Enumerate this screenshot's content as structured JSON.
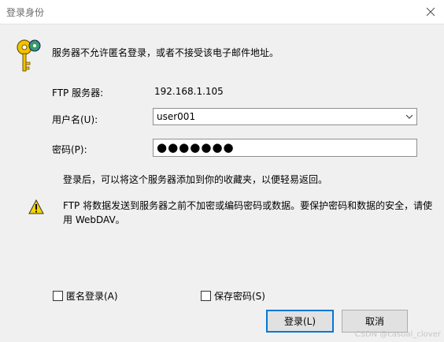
{
  "window": {
    "title": "登录身份"
  },
  "message": "服务器不允许匿名登录，或者不接受该电子邮件地址。",
  "form": {
    "server_label": "FTP 服务器:",
    "server_value": "192.168.1.105",
    "username_label": "用户名(U):",
    "username_value": "user001",
    "password_label": "密码(P):",
    "password_mask": "●●●●●●●"
  },
  "hint": "登录后，可以将这个服务器添加到你的收藏夹，以便轻易返回。",
  "warning": "FTP 将数据发送到服务器之前不加密或编码密码或数据。要保护密码和数据的安全，请使用 WebDAV。",
  "options": {
    "anonymous_label": "匿名登录(A)",
    "anonymous_checked": false,
    "save_password_label": "保存密码(S)",
    "save_password_checked": false
  },
  "buttons": {
    "login": "登录(L)",
    "cancel": "取消"
  },
  "watermark": "CSDN @casual_clover",
  "icons": [
    "keys-icon",
    "close-icon",
    "dropdown-arrow-icon",
    "warning-icon"
  ],
  "colors": {
    "title_text": "#6b6b6b",
    "focus_border": "#0078d7",
    "warning_yellow": "#f5d400"
  }
}
